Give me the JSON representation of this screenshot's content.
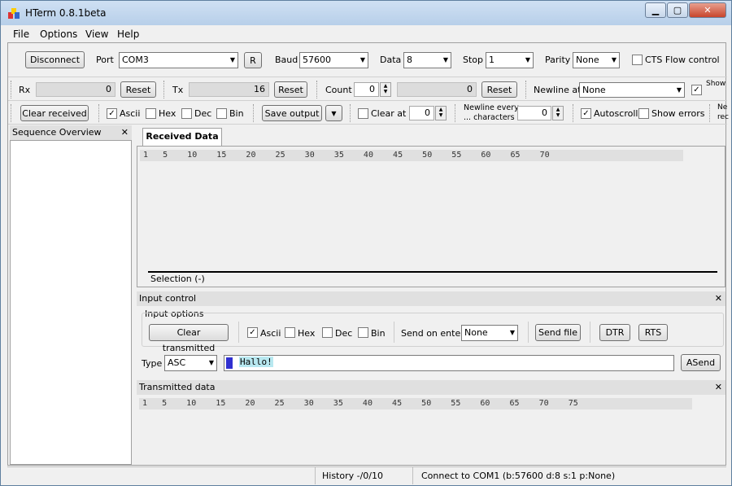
{
  "window": {
    "title": "HTerm 0.8.1beta",
    "minimize": "▁",
    "maximize": "▢",
    "close": "✕"
  },
  "menu": {
    "file": "File",
    "options": "Options",
    "view": "View",
    "help": "Help"
  },
  "conn": {
    "disconnect": "Disconnect",
    "port_label": "Port",
    "port_value": "COM3",
    "r": "R",
    "baud_label": "Baud",
    "baud_value": "57600",
    "data_label": "Data",
    "data_value": "8",
    "stop_label": "Stop",
    "stop_value": "1",
    "parity_label": "Parity",
    "parity_value": "None",
    "cts": "CTS Flow control"
  },
  "counters": {
    "rx_label": "Rx",
    "rx_value": "0",
    "rx_reset": "Reset",
    "tx_label": "Tx",
    "tx_value": "16",
    "tx_reset": "Reset",
    "count_label": "Count",
    "count_value": "0",
    "count_total": "0",
    "count_reset": "Reset",
    "newline_label": "Newline at",
    "newline_value": "None",
    "show_char": "Show charac"
  },
  "recvopts": {
    "clear_received": "Clear received",
    "ascii": "Ascii",
    "hex": "Hex",
    "dec": "Dec",
    "bin": "Bin",
    "save_output": "Save output",
    "clear_at": "Clear at",
    "clear_at_value": "0",
    "newline_every_1": "Newline every",
    "newline_every_2": "... characters",
    "newline_every_value": "0",
    "autoscroll": "Autoscroll",
    "show_errors": "Show errors",
    "ne": "Ne",
    "rec": "rec"
  },
  "sidebar": {
    "title": "Sequence Overview",
    "close": "✕"
  },
  "received": {
    "tab": "Received Data",
    "ruler": "1   5    10    15    20    25    30    35    40    45    50    55    60    65    70",
    "selection": "Selection (-)"
  },
  "input": {
    "header": "Input control",
    "close": "✕",
    "options_label": "Input options",
    "clear_transmitted": "Clear transmitted",
    "ascii": "Ascii",
    "hex": "Hex",
    "dec": "Dec",
    "bin": "Bin",
    "send_on_enter_label": "Send on enter",
    "send_on_enter_value": "None",
    "send_file": "Send file",
    "dtr": "DTR",
    "rts": "RTS",
    "type_label": "Type",
    "type_value": "ASC",
    "text": "Hallo!",
    "asend": "ASend"
  },
  "transmitted": {
    "header": "Transmitted data",
    "close": "✕",
    "ruler": "1   5    10    15    20    25    30    35    40    45    50    55    60    65    70    75"
  },
  "status": {
    "history": "History -/0/10",
    "connect": "Connect to COM1 (b:57600 d:8 s:1 p:None)"
  },
  "icons": {
    "check": "✓",
    "dropdown": "▼",
    "spin_up": "▲",
    "spin_down": "▼"
  }
}
